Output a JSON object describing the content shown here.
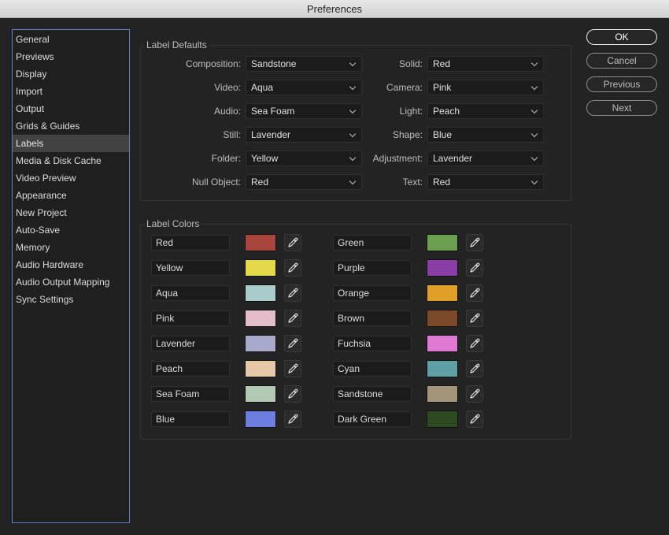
{
  "window": {
    "title": "Preferences"
  },
  "sidebar": {
    "items": [
      {
        "label": "General"
      },
      {
        "label": "Previews"
      },
      {
        "label": "Display"
      },
      {
        "label": "Import"
      },
      {
        "label": "Output"
      },
      {
        "label": "Grids & Guides"
      },
      {
        "label": "Labels",
        "selected": true
      },
      {
        "label": "Media & Disk Cache"
      },
      {
        "label": "Video Preview"
      },
      {
        "label": "Appearance"
      },
      {
        "label": "New Project"
      },
      {
        "label": "Auto-Save"
      },
      {
        "label": "Memory"
      },
      {
        "label": "Audio Hardware"
      },
      {
        "label": "Audio Output Mapping"
      },
      {
        "label": "Sync Settings"
      }
    ]
  },
  "label_defaults": {
    "title": "Label Defaults",
    "left": [
      {
        "label": "Composition:",
        "value": "Sandstone"
      },
      {
        "label": "Video:",
        "value": "Aqua"
      },
      {
        "label": "Audio:",
        "value": "Sea Foam"
      },
      {
        "label": "Still:",
        "value": "Lavender"
      },
      {
        "label": "Folder:",
        "value": "Yellow"
      },
      {
        "label": "Null Object:",
        "value": "Red"
      }
    ],
    "right": [
      {
        "label": "Solid:",
        "value": "Red"
      },
      {
        "label": "Camera:",
        "value": "Pink"
      },
      {
        "label": "Light:",
        "value": "Peach"
      },
      {
        "label": "Shape:",
        "value": "Blue"
      },
      {
        "label": "Adjustment:",
        "value": "Lavender"
      },
      {
        "label": "Text:",
        "value": "Red"
      }
    ]
  },
  "label_colors": {
    "title": "Label Colors",
    "left": [
      {
        "name": "Red",
        "color": "#a8453d"
      },
      {
        "name": "Yellow",
        "color": "#e3d94a"
      },
      {
        "name": "Aqua",
        "color": "#a9ccca"
      },
      {
        "name": "Pink",
        "color": "#e4bdcb"
      },
      {
        "name": "Lavender",
        "color": "#a9a9cb"
      },
      {
        "name": "Peach",
        "color": "#e4c8a8"
      },
      {
        "name": "Sea Foam",
        "color": "#b4c9b4"
      },
      {
        "name": "Blue",
        "color": "#6c7fe0"
      }
    ],
    "right": [
      {
        "name": "Green",
        "color": "#6aa050"
      },
      {
        "name": "Purple",
        "color": "#8a3da4"
      },
      {
        "name": "Orange",
        "color": "#e0a028"
      },
      {
        "name": "Brown",
        "color": "#7a4a2a"
      },
      {
        "name": "Fuchsia",
        "color": "#e07ad4"
      },
      {
        "name": "Cyan",
        "color": "#5fa0a6"
      },
      {
        "name": "Sandstone",
        "color": "#a3957a"
      },
      {
        "name": "Dark Green",
        "color": "#2e4a22"
      }
    ]
  },
  "buttons": {
    "ok": "OK",
    "cancel": "Cancel",
    "previous": "Previous",
    "next": "Next"
  },
  "icons": {
    "dropdown": "chevron-down-icon",
    "eyedropper": "eyedropper-icon"
  }
}
